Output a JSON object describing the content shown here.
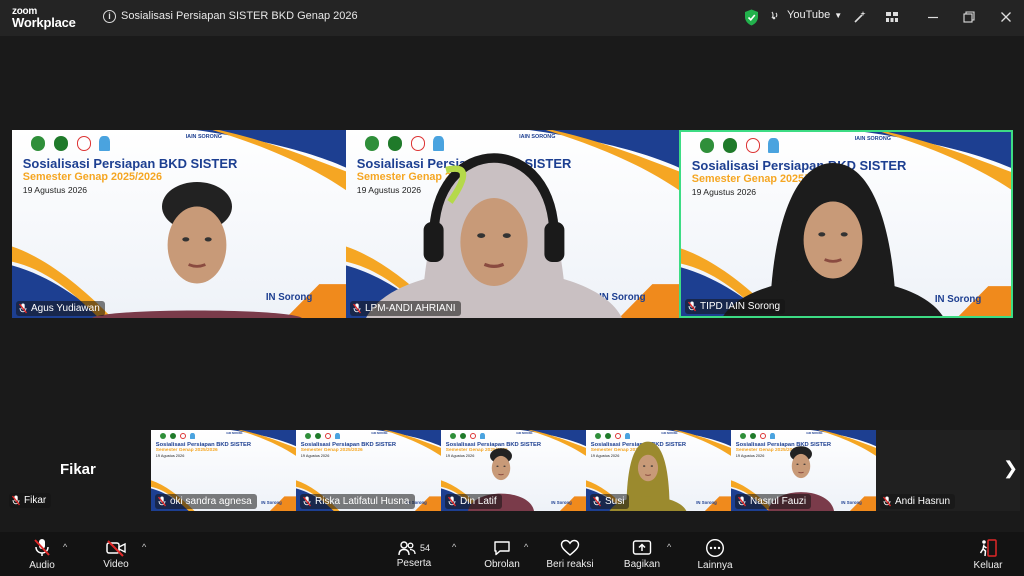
{
  "app": {
    "logo_line1": "zoom",
    "logo_line2": "Workplace",
    "meeting_title": "Sosialisasi Persiapan SISTER BKD Genap 2026",
    "stream_label": "YouTube"
  },
  "slide": {
    "title": "Sosialisasi Persiapan BKD SISTER",
    "subtitle": "Semester Genap 2025/2026",
    "date": "19 Agustus 2026",
    "footer": "IAIN Sorong",
    "footer_short": "IN Sorong",
    "brand": "IAIN SORONG"
  },
  "main_tiles": [
    {
      "name": "Agus Yudiawan"
    },
    {
      "name": "LPM-ANDI AHRIANI"
    },
    {
      "name": "TIPD IAIN Sorong"
    }
  ],
  "strip": {
    "self_name": "Fikar",
    "self_label": "Fikar",
    "tiles": [
      {
        "name": "oki sandra agnesa"
      },
      {
        "name": "Riska Latifatul Husna"
      },
      {
        "name": "Din Latif"
      },
      {
        "name": "Susi"
      },
      {
        "name": "Nasrul Fauzi"
      },
      {
        "name": "Andi Hasrun"
      }
    ]
  },
  "toolbar": {
    "audio": "Audio",
    "video": "Video",
    "participants": "Peserta",
    "participants_count": "54",
    "chat": "Obrolan",
    "reactions": "Beri reaksi",
    "share": "Bagikan",
    "more": "Lainnya",
    "leave": "Keluar"
  },
  "colors": {
    "active_speaker": "#3ddc84",
    "brand_blue": "#1d3f91",
    "brand_orange": "#f5a623",
    "mic_off": "#e02828"
  }
}
